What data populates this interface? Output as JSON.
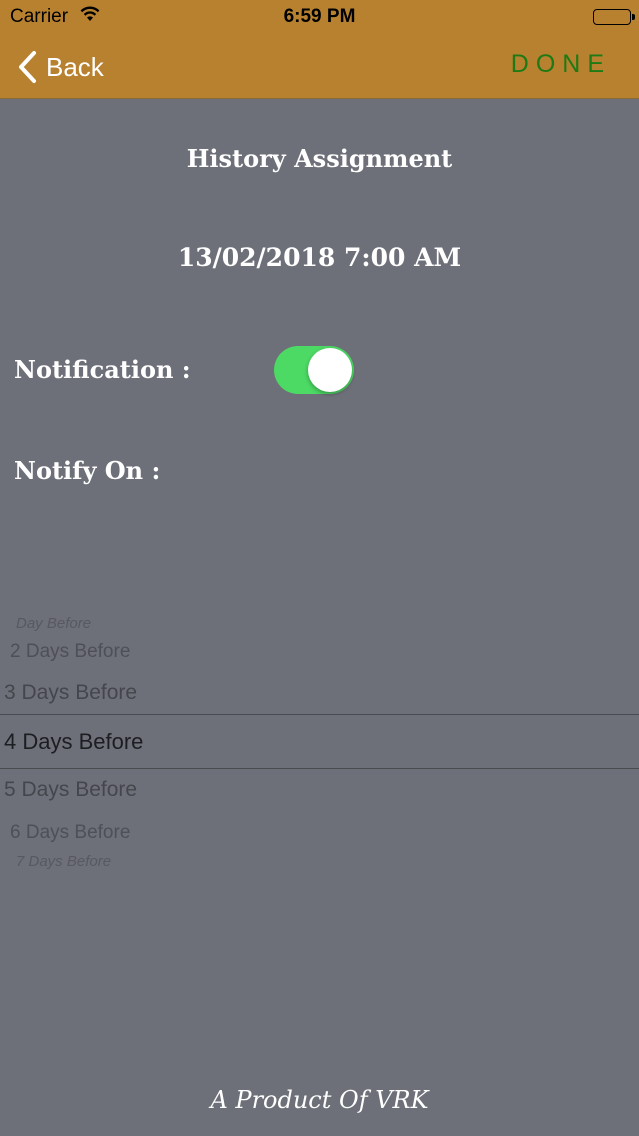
{
  "status_bar": {
    "carrier": "Carrier",
    "time": "6:59 PM"
  },
  "nav": {
    "back_label": "Back",
    "done_label": "DONE"
  },
  "main": {
    "title": "History Assignment",
    "datetime": "13/02/2018 7:00 AM",
    "notification_label": "Notification :",
    "notification_enabled": true,
    "notify_on_label": "Notify On :"
  },
  "picker": {
    "selected": "4 Days Before",
    "items": [
      "Day Before",
      "2 Days Before",
      "3 Days Before",
      "4 Days Before",
      "5 Days Before",
      "6 Days Before",
      "7 Days Before"
    ]
  },
  "footer": {
    "text": "A Product Of VRK"
  },
  "colors": {
    "header_bg": "#b88130",
    "page_bg": "#6e7079",
    "done_text": "#1e7a14",
    "toggle_on": "#4cd964"
  }
}
